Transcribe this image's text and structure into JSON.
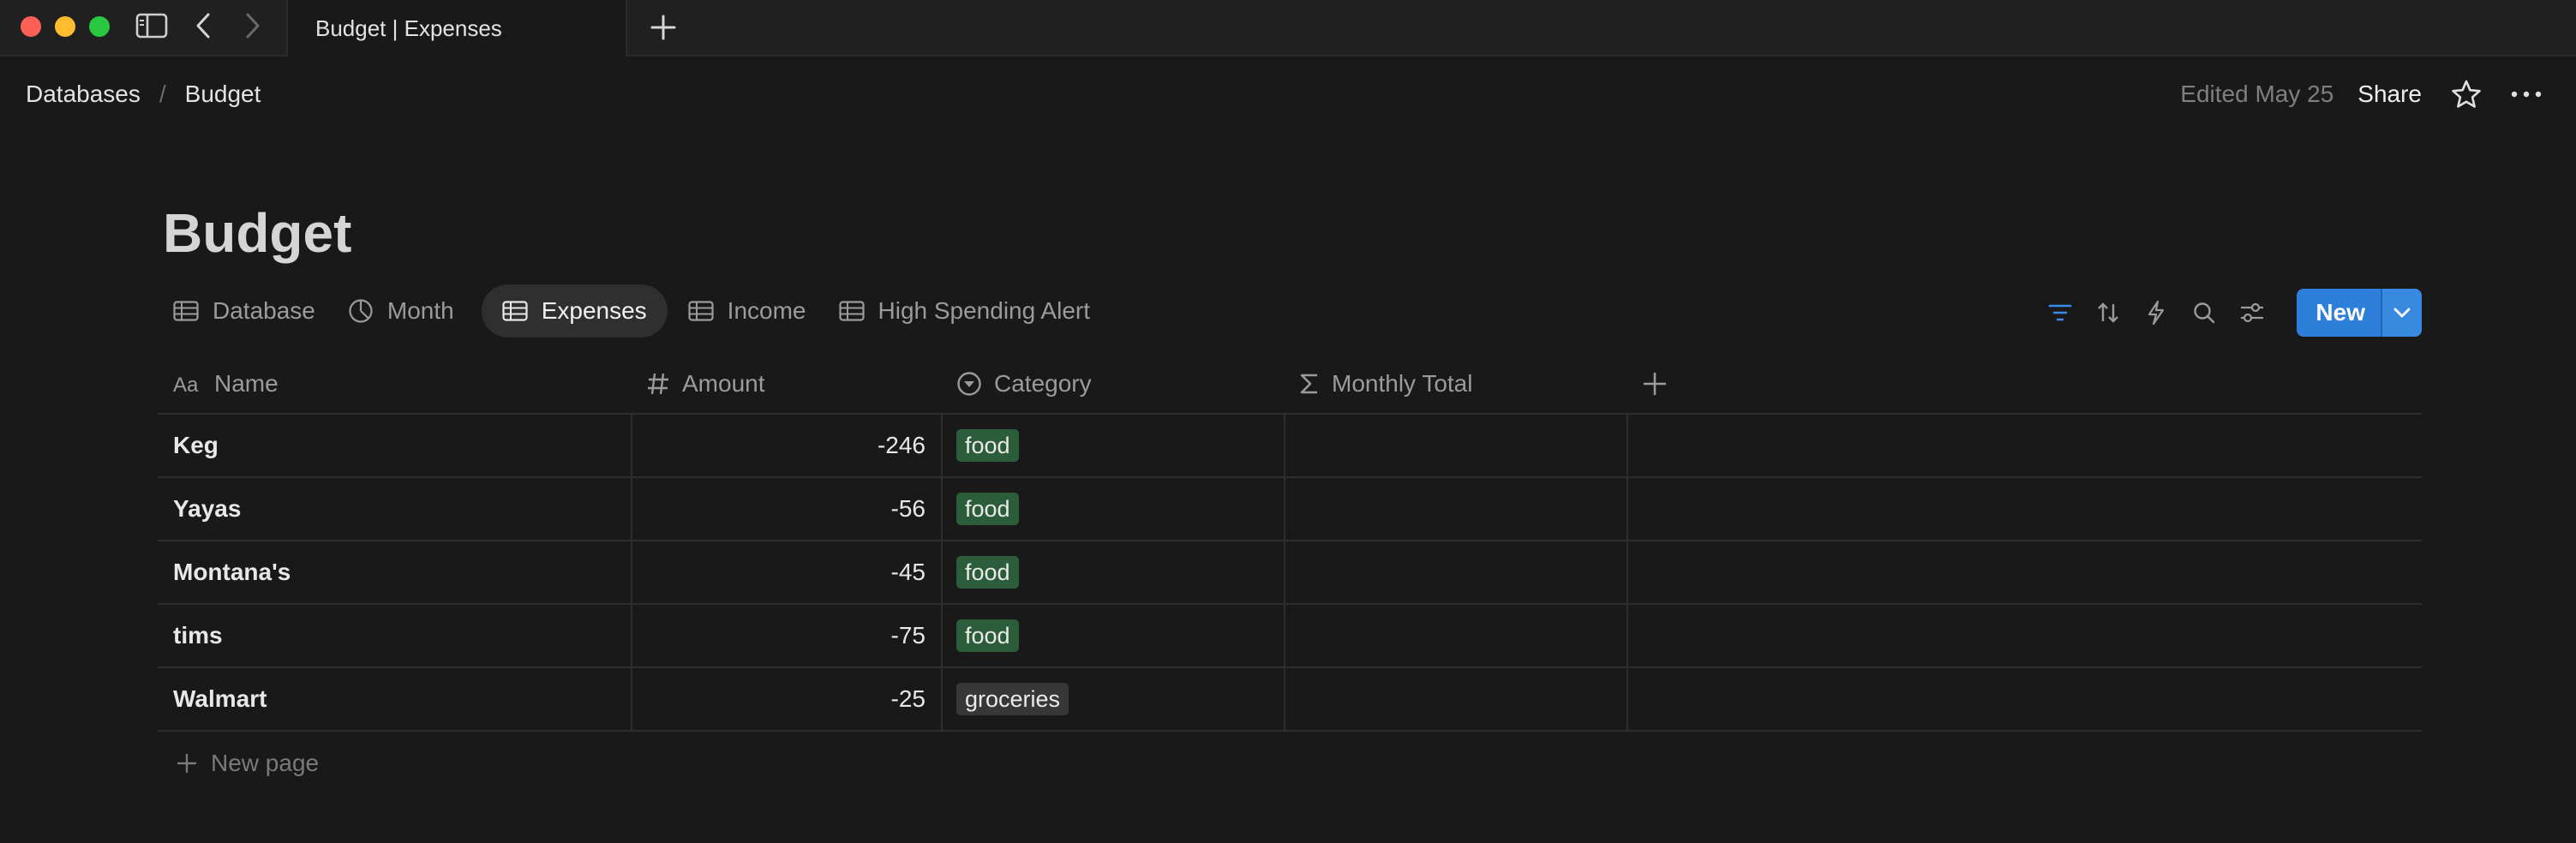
{
  "window": {
    "tab_title": "Budget | Expenses"
  },
  "topbar": {
    "breadcrumb": [
      "Databases",
      "Budget"
    ],
    "edited": "Edited May 25",
    "share_label": "Share"
  },
  "page": {
    "title": "Budget"
  },
  "views": [
    {
      "label": "Database",
      "icon": "table-icon",
      "active": false
    },
    {
      "label": "Month",
      "icon": "chart-icon",
      "active": false
    },
    {
      "label": "Expenses",
      "icon": "table-icon",
      "active": true
    },
    {
      "label": "Income",
      "icon": "table-icon",
      "active": false
    },
    {
      "label": "High Spending Alert",
      "icon": "table-icon",
      "active": false
    }
  ],
  "toolbar": {
    "new_label": "New",
    "accent": "#2e7fd9"
  },
  "table": {
    "columns": [
      {
        "label": "Name",
        "icon": "text-icon"
      },
      {
        "label": "Amount",
        "icon": "number-icon"
      },
      {
        "label": "Category",
        "icon": "select-icon"
      },
      {
        "label": "Monthly Total",
        "icon": "sigma-icon"
      }
    ],
    "rows": [
      {
        "name": "Keg",
        "amount": "-246",
        "category": "food",
        "category_color": "#2b5d3a"
      },
      {
        "name": "Yayas",
        "amount": "-56",
        "category": "food",
        "category_color": "#2b5d3a"
      },
      {
        "name": "Montana's",
        "amount": "-45",
        "category": "food",
        "category_color": "#2b5d3a"
      },
      {
        "name": "tims",
        "amount": "-75",
        "category": "food",
        "category_color": "#2b5d3a"
      },
      {
        "name": "Walmart",
        "amount": "-25",
        "category": "groceries",
        "category_color": "#373737"
      }
    ],
    "new_page_label": "New page"
  }
}
